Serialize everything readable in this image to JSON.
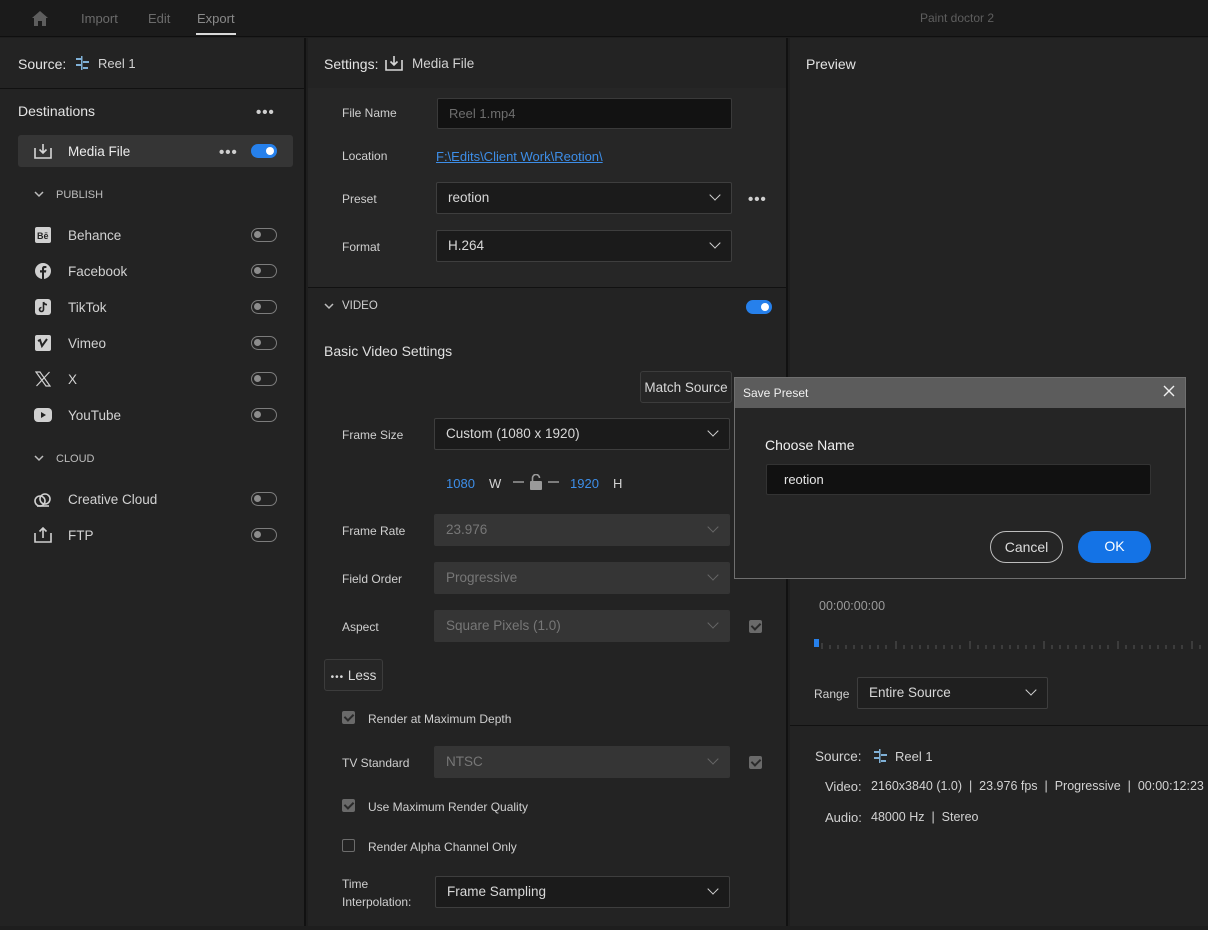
{
  "topbar": {
    "nav": [
      "Import",
      "Edit",
      "Export"
    ],
    "active": "Export",
    "project": "Paint doctor 2"
  },
  "left": {
    "source_label": "Source:",
    "source_name": "Reel 1",
    "destinations_title": "Destinations",
    "media_file": {
      "label": "Media File",
      "enabled": true
    },
    "publish_title": "PUBLISH",
    "publish": [
      {
        "label": "Behance",
        "icon": "behance-icon",
        "enabled": false
      },
      {
        "label": "Facebook",
        "icon": "facebook-icon",
        "enabled": false
      },
      {
        "label": "TikTok",
        "icon": "tiktok-icon",
        "enabled": false
      },
      {
        "label": "Vimeo",
        "icon": "vimeo-icon",
        "enabled": false
      },
      {
        "label": "X",
        "icon": "x-icon",
        "enabled": false
      },
      {
        "label": "YouTube",
        "icon": "youtube-icon",
        "enabled": false
      }
    ],
    "cloud_title": "CLOUD",
    "cloud": [
      {
        "label": "Creative Cloud",
        "icon": "creative-cloud-icon",
        "enabled": false
      },
      {
        "label": "FTP",
        "icon": "ftp-icon",
        "enabled": false
      }
    ]
  },
  "settings": {
    "title": "Settings:",
    "target": "Media File",
    "file_name_label": "File Name",
    "file_name_value": "Reel 1.mp4",
    "location_label": "Location",
    "location_value": "F:\\Edits\\Client Work\\Reotion\\",
    "preset_label": "Preset",
    "preset_value": "reotion",
    "format_label": "Format",
    "format_value": "H.264",
    "video_section": "VIDEO",
    "video_enabled": true,
    "basic_title": "Basic Video Settings",
    "match_source": "Match Source",
    "frame_size_label": "Frame Size",
    "frame_size_value": "Custom (1080 x 1920)",
    "width": "1080",
    "w": "W",
    "height": "1920",
    "h": "H",
    "frame_rate_label": "Frame Rate",
    "frame_rate_value": "23.976",
    "field_order_label": "Field Order",
    "field_order_value": "Progressive",
    "aspect_label": "Aspect",
    "aspect_value": "Square Pixels (1.0)",
    "less_button": "Less",
    "render_max_depth": "Render at Maximum Depth",
    "tv_standard_label": "TV Standard",
    "tv_standard_value": "NTSC",
    "max_render_quality": "Use Maximum Render Quality",
    "render_alpha": "Render Alpha Channel Only",
    "time_interp_label_1": "Time",
    "time_interp_label_2": "Interpolation:",
    "time_interp_value": "Frame Sampling"
  },
  "preview": {
    "title": "Preview",
    "timecode": "00:00:00:00",
    "range_label": "Range",
    "range_value": "Entire Source",
    "source_label": "Source:",
    "source_name": "Reel 1",
    "video_label": "Video:",
    "video_value": "2160x3840 (1.0)  |  23.976 fps  |  Progressive  |  00:00:12:23",
    "audio_label": "Audio:",
    "audio_value": "48000 Hz  |  Stereo"
  },
  "modal": {
    "title": "Save Preset",
    "choose_name": "Choose Name",
    "name_value": "reotion",
    "cancel": "Cancel",
    "ok": "OK"
  },
  "colors": {
    "accent": "#2680eb",
    "link": "#3d8ee8"
  }
}
